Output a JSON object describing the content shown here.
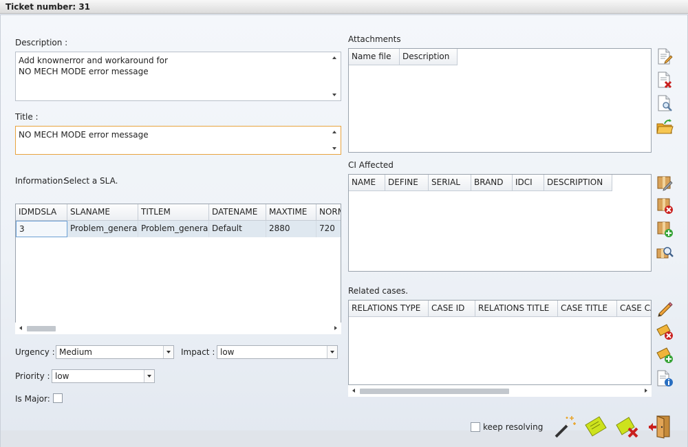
{
  "window": {
    "title": "Ticket number: 31"
  },
  "description": {
    "label": "Description :",
    "value": "Add knownerror and workaround for\nNO MECH MODE error message"
  },
  "title_field": {
    "label": "Title :",
    "value": "NO MECH MODE error message"
  },
  "information": {
    "label": "Information:",
    "hint": "Select a SLA."
  },
  "sla_table": {
    "columns": [
      "IDMDSLA",
      "SLANAME",
      "TITLEM",
      "DATENAME",
      "MAXTIME",
      "NORM"
    ],
    "rows": [
      [
        "3",
        "Problem_general",
        "Problem_general",
        "Default",
        "2880",
        "720"
      ]
    ]
  },
  "urgency": {
    "label": "Urgency :",
    "value": "Medium"
  },
  "impact": {
    "label": "Impact :",
    "value": "low"
  },
  "priority": {
    "label": "Priority :",
    "value": "low"
  },
  "is_major": {
    "label": "Is Major:",
    "checked": false
  },
  "attachments": {
    "label": "Attachments",
    "columns": [
      "Name file",
      "Description"
    ]
  },
  "ci_affected": {
    "label": "CI Affected",
    "columns": [
      "NAME",
      "DEFINE",
      "SERIAL",
      "BRAND",
      "IDCI",
      "DESCRIPTION"
    ]
  },
  "related_cases": {
    "label": "Related cases.",
    "columns": [
      "RELATIONS TYPE",
      "CASE ID",
      "RELATIONS TITLE",
      "CASE TITLE",
      "CASE CA"
    ]
  },
  "footer": {
    "keep_resolving_label": "keep resolving",
    "keep_resolving_checked": false
  },
  "icons": {
    "attachments": [
      "edit-document-icon",
      "delete-document-icon",
      "view-document-icon",
      "open-folder-icon"
    ],
    "ci": [
      "box-edit-icon",
      "box-delete-icon",
      "box-add-icon",
      "box-search-icon"
    ],
    "related": [
      "pencil-icon",
      "ticket-delete-icon",
      "ticket-add-icon",
      "document-info-icon"
    ],
    "footer": [
      "magic-wand-icon",
      "ticket-icon",
      "ticket-cancel-icon",
      "exit-door-icon"
    ]
  },
  "colors": {
    "title_border": "#e8a33d",
    "selected_row": "#dfe8f0",
    "delete_red": "#c9201e",
    "add_green": "#3aa53a",
    "ticket_yellow": "#cde21d"
  }
}
